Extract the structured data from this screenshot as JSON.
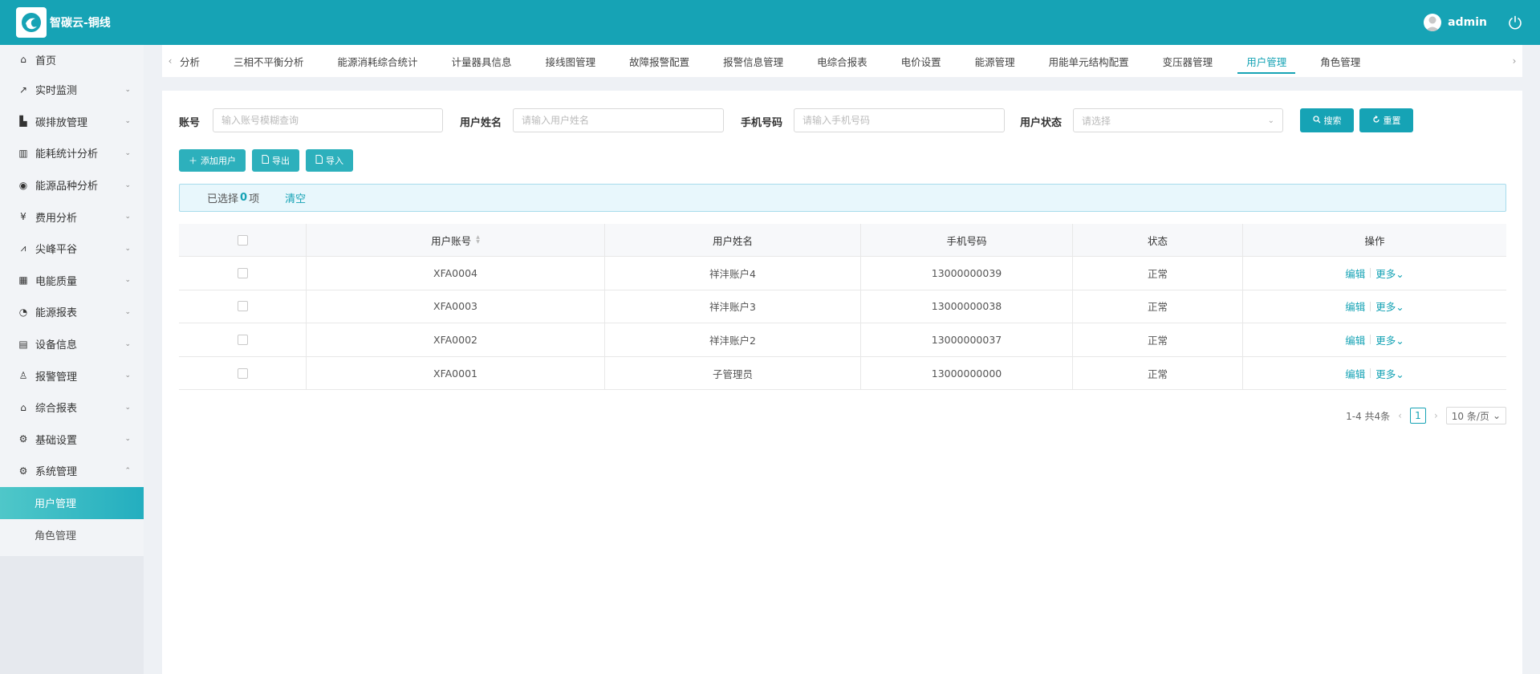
{
  "header": {
    "app_title": "智碳云-铜线",
    "username": "admin"
  },
  "colors": {
    "primary": "#16a3b5",
    "sidebar_active": "#23aebf",
    "selected_bar_bg": "#e8f7fc"
  },
  "sidebar": {
    "items": [
      {
        "label": "首页",
        "icon": "home-icon"
      },
      {
        "label": "实时监测",
        "icon": "trend-icon"
      },
      {
        "label": "碳排放管理",
        "icon": "bar-chart-icon"
      },
      {
        "label": "能耗统计分析",
        "icon": "bar-chart-icon"
      },
      {
        "label": "能源品种分析",
        "icon": "signal-icon"
      },
      {
        "label": "费用分析",
        "icon": "yen-icon"
      },
      {
        "label": "尖峰平谷",
        "icon": "line-chart-icon"
      },
      {
        "label": "电能质量",
        "icon": "calendar-icon"
      },
      {
        "label": "能源报表",
        "icon": "pie-chart-icon"
      },
      {
        "label": "设备信息",
        "icon": "file-icon"
      },
      {
        "label": "报警管理",
        "icon": "alarm-icon"
      },
      {
        "label": "综合报表",
        "icon": "bank-icon"
      },
      {
        "label": "基础设置",
        "icon": "settings-icon"
      },
      {
        "label": "系统管理",
        "icon": "settings-icon"
      }
    ],
    "sub_items": [
      {
        "label": "用户管理"
      },
      {
        "label": "角色管理"
      }
    ]
  },
  "tabs": [
    "分析",
    "三相不平衡分析",
    "能源消耗综合统计",
    "计量器具信息",
    "接线图管理",
    "故障报警配置",
    "报警信息管理",
    "电综合报表",
    "电价设置",
    "能源管理",
    "用能单元结构配置",
    "变压器管理",
    "用户管理",
    "角色管理"
  ],
  "filters": {
    "account_label": "账号",
    "account_placeholder": "输入账号模糊查询",
    "name_label": "用户姓名",
    "name_placeholder": "请输入用户姓名",
    "phone_label": "手机号码",
    "phone_placeholder": "请输入手机号码",
    "status_label": "用户状态",
    "status_placeholder": "请选择",
    "search_label": "搜索",
    "reset_label": "重置"
  },
  "actions": {
    "add_label": "添加用户",
    "export_label": "导出",
    "import_label": "导入"
  },
  "selection": {
    "prefix": "已选择",
    "count": "0",
    "suffix": "项",
    "clear_label": "清空"
  },
  "table": {
    "headers": [
      "用户账号",
      "用户姓名",
      "手机号码",
      "状态",
      "操作"
    ],
    "rows": [
      {
        "account": "XFA0004",
        "name": "祥沣账户4",
        "phone": "13000000039",
        "status": "正常"
      },
      {
        "account": "XFA0003",
        "name": "祥沣账户3",
        "phone": "13000000038",
        "status": "正常"
      },
      {
        "account": "XFA0002",
        "name": "祥沣账户2",
        "phone": "13000000037",
        "status": "正常"
      },
      {
        "account": "XFA0001",
        "name": "子管理员",
        "phone": "13000000000",
        "status": "正常"
      }
    ],
    "edit_label": "编辑",
    "more_label": "更多"
  },
  "pagination": {
    "summary": "1-4 共4条",
    "current_page": "1",
    "page_size": "10 条/页"
  }
}
